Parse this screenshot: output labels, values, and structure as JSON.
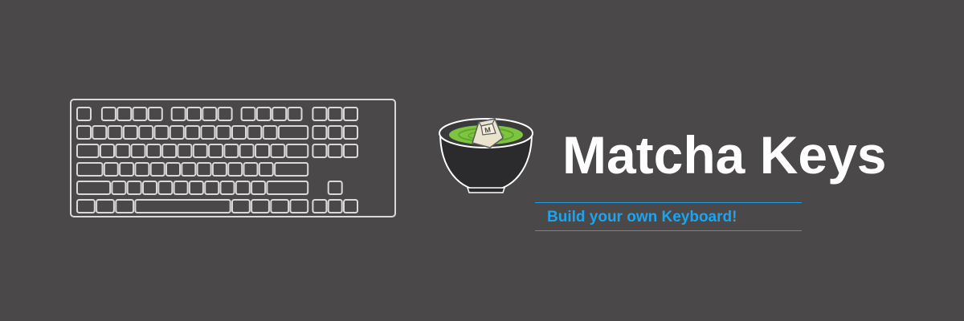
{
  "brand": {
    "name": "Matcha Keys",
    "tagline": "Build your own Keyboard!",
    "logo_keycap_letter": "M"
  },
  "colors": {
    "background": "#4a4849",
    "keyboard_outline": "#d9d9d9",
    "title": "#ffffff",
    "tagline": "#1ea3ef",
    "bowl": "#2a2a2c",
    "matcha": "#7dc540",
    "keycap": "#eae4cf"
  },
  "icons": [
    "keyboard-icon",
    "matcha-bowl-icon",
    "keycap-icon"
  ]
}
